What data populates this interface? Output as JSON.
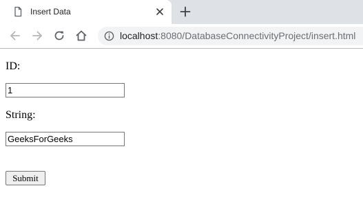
{
  "browser": {
    "tab": {
      "title": "Insert Data",
      "page_icon": "page-icon",
      "close_icon": "close-icon"
    },
    "new_tab_icon": "plus-icon",
    "nav": {
      "back_icon": "arrow-left-icon",
      "forward_icon": "arrow-right-icon",
      "reload_icon": "reload-icon",
      "home_icon": "home-icon"
    },
    "address_bar": {
      "info_icon": "info-icon",
      "host": "localhost",
      "rest": ":8080/DatabaseConnectivityProject/insert.html"
    }
  },
  "form": {
    "id_label": "ID:",
    "id_value": "1",
    "string_label": "String:",
    "string_value": "GeeksForGeeks",
    "submit_label": "Submit"
  }
}
